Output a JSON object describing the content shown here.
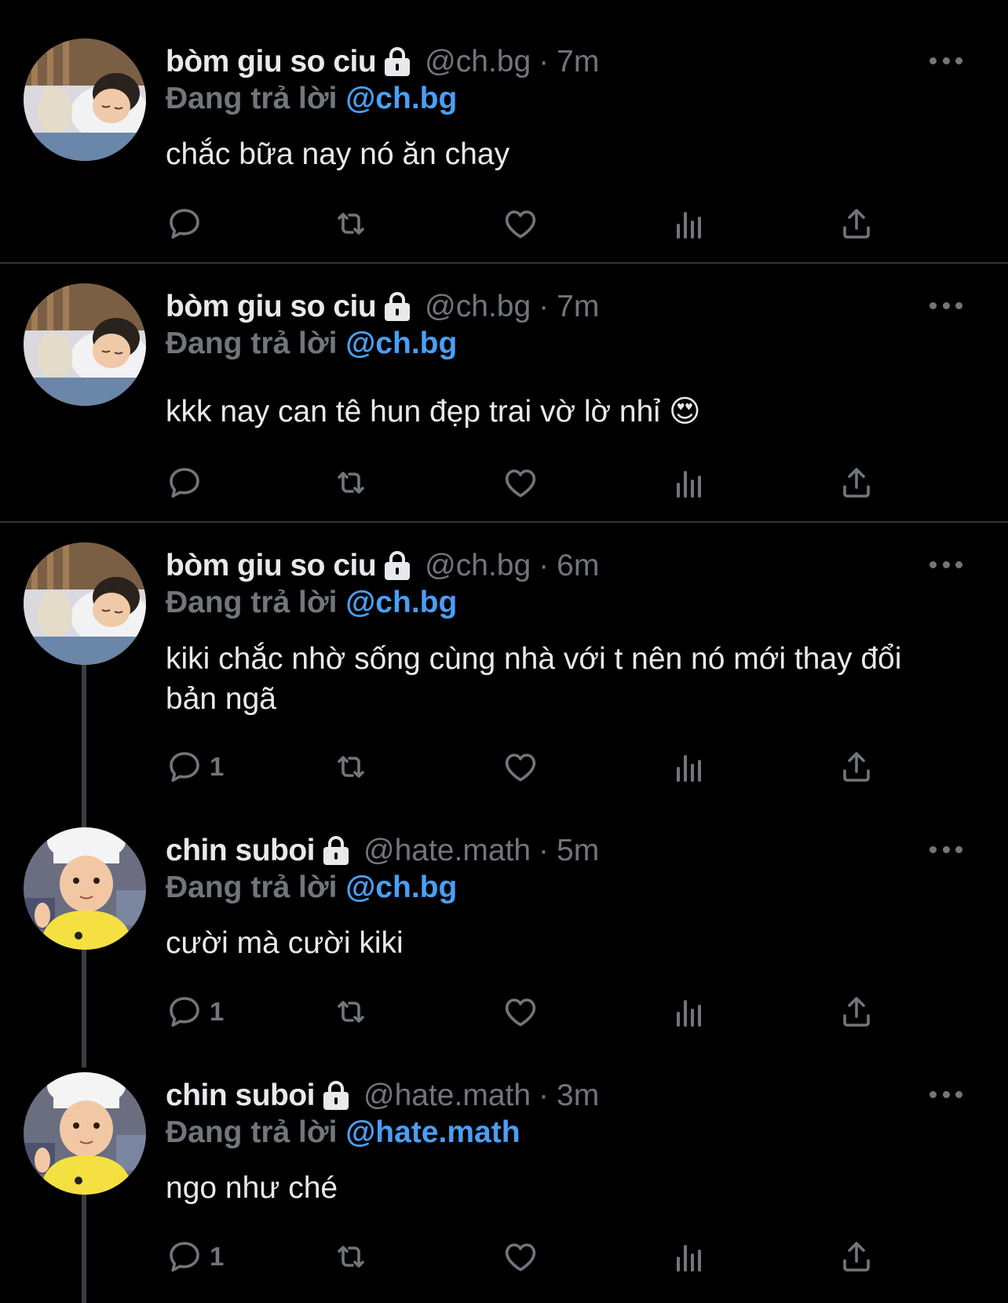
{
  "tweets": [
    {
      "name": "bòm giu so ciu",
      "handle": "@ch.bg",
      "separator": "·",
      "time": "7m",
      "reply_label": "Đang trả lời",
      "reply_to": "@ch.bg",
      "text": "chắc bữa nay nó ăn chay",
      "reply_count": "",
      "avatar": "sleeping-child"
    },
    {
      "name": "bòm giu so ciu",
      "handle": "@ch.bg",
      "separator": "·",
      "time": "7m",
      "reply_label": "Đang trả lời",
      "reply_to": "@ch.bg",
      "text": "kkk nay can tê hun đẹp trai vờ lờ nhỉ 😍",
      "reply_count": "",
      "avatar": "sleeping-child"
    },
    {
      "name": "bòm giu so ciu",
      "handle": "@ch.bg",
      "separator": "·",
      "time": "6m",
      "reply_label": "Đang trả lời",
      "reply_to": "@ch.bg",
      "text": "kiki chắc nhờ sống cùng nhà với t nên nó mới thay đổi bản ngã",
      "reply_count": "1",
      "avatar": "sleeping-child"
    },
    {
      "name": "chin suboi",
      "handle": "@hate.math",
      "separator": "·",
      "time": "5m",
      "reply_label": "Đang trả lời",
      "reply_to": "@ch.bg",
      "text": "cười mà cười kiki",
      "reply_count": "1",
      "avatar": "child-chef-hat"
    },
    {
      "name": "chin suboi",
      "handle": "@hate.math",
      "separator": "·",
      "time": "3m",
      "reply_label": "Đang trả lời",
      "reply_to": "@hate.math",
      "text": "ngo như ché",
      "reply_count": "1",
      "avatar": "child-chef-hat"
    }
  ],
  "colors": {
    "background": "#000000",
    "text": "#e7e9ea",
    "muted": "#71767b",
    "mention": "#4a9ff5",
    "divider": "#2f3336"
  },
  "icons": [
    "lock-icon",
    "more-icon",
    "reply-icon",
    "retweet-icon",
    "like-icon",
    "views-icon",
    "share-icon"
  ]
}
